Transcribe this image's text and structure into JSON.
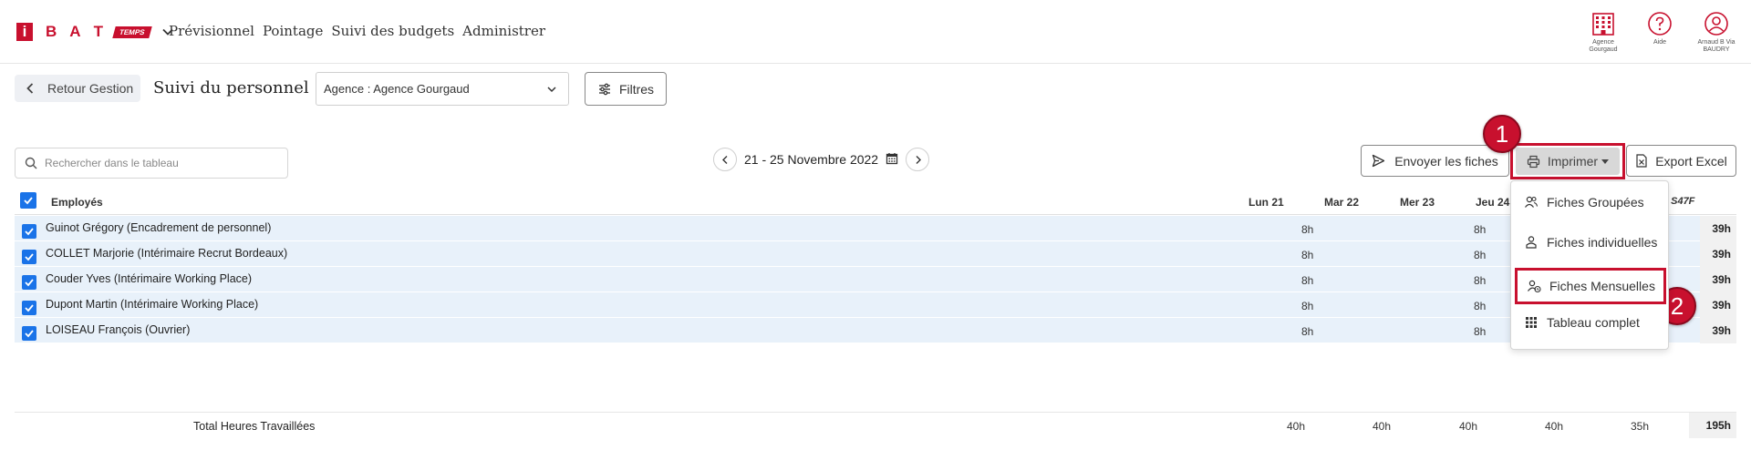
{
  "brand": {
    "logo_i": "i",
    "logo_letters": [
      "B",
      "A",
      "T"
    ],
    "logo_tag": "TEMPS",
    "accent": "#c8102e"
  },
  "nav": {
    "items": [
      "Prévisionnel",
      "Pointage",
      "Suivi des budgets",
      "Administrer"
    ]
  },
  "top_icons": [
    {
      "icon": "building-icon",
      "label": "Agence Gourgaud"
    },
    {
      "icon": "help-icon",
      "label": "Aide"
    },
    {
      "icon": "user-icon",
      "label": "Arnaud B Via BAUDRY"
    }
  ],
  "toolbar": {
    "back_label": "Retour Gestion",
    "page_title": "Suivi du personnel",
    "agency_select": "Agence : Agence Gourgaud",
    "filters_label": "Filtres"
  },
  "search": {
    "placeholder": "Rechercher dans le tableau"
  },
  "date_range": "21 - 25 Novembre 2022",
  "actions": {
    "send_label": "Envoyer les fiches",
    "print_label": "Imprimer",
    "excel_label": "Export Excel"
  },
  "print_menu": {
    "items": [
      "Fiches Groupées",
      "Fiches individuelles",
      "Fiches Mensuelles",
      "Tableau complet"
    ]
  },
  "badges": [
    "1",
    "2"
  ],
  "table": {
    "columns": {
      "employees": "Employés",
      "mon": "Lun 21",
      "tue": "Mar 22",
      "wed": "Mer 23",
      "thu": "Jeu 24",
      "week": ". S47F"
    },
    "rows": [
      {
        "name": "Guinot Grégory (Encadrement de personnel)",
        "mon": "8h",
        "thu": "8h",
        "total": "39h"
      },
      {
        "name": "COLLET Marjorie (Intérimaire Recrut Bordeaux)",
        "mon": "8h",
        "thu": "8h",
        "total": "39h"
      },
      {
        "name": "Couder Yves (Intérimaire Working Place)",
        "mon": "8h",
        "thu": "8h",
        "total": "39h"
      },
      {
        "name": "Dupont Martin (Intérimaire Working Place)",
        "mon": "8h",
        "thu": "8h",
        "total": "39h"
      },
      {
        "name": "LOISEAU François (Ouvrier)",
        "mon": "8h",
        "thu": "8h",
        "total": "39h"
      }
    ],
    "footer": {
      "label": "Total Heures Travaillées",
      "values": [
        "40h",
        "40h",
        "40h",
        "40h",
        "35h"
      ],
      "grand_total": "195h"
    }
  }
}
